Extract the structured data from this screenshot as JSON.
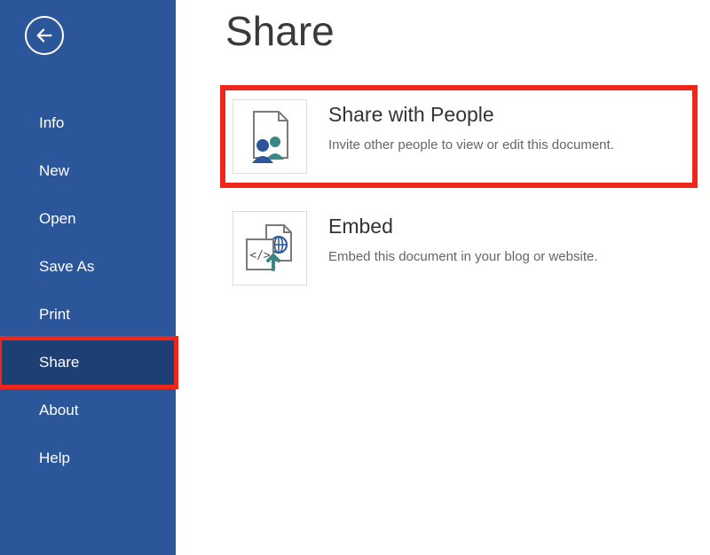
{
  "sidebar": {
    "items": [
      {
        "label": "Info"
      },
      {
        "label": "New"
      },
      {
        "label": "Open"
      },
      {
        "label": "Save As"
      },
      {
        "label": "Print"
      },
      {
        "label": "Share"
      },
      {
        "label": "About"
      },
      {
        "label": "Help"
      }
    ]
  },
  "page": {
    "title": "Share"
  },
  "options": {
    "share_people": {
      "title": "Share with People",
      "desc": "Invite other people to view or edit this document."
    },
    "embed": {
      "title": "Embed",
      "desc": "Embed this document in your blog or website."
    }
  }
}
